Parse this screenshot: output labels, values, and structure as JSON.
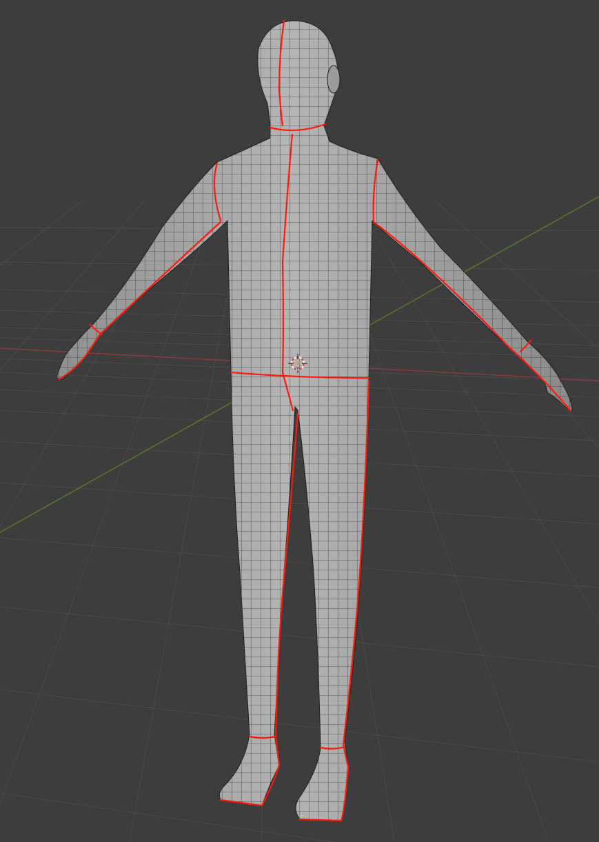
{
  "viewport": {
    "name": "3D Viewport",
    "background_color": "#3d3d3d",
    "grid_color": "#4a4a4a",
    "x_axis_color": "#8a3a43",
    "y_axis_color": "#5d7a2e"
  },
  "mesh": {
    "object": "human-base-mesh",
    "surface_color": "#a9a9a9",
    "wire_color": "#1e1e1e",
    "seam_color": "#ff1a0a"
  },
  "cursor": {
    "icon": "3d-cursor-icon",
    "ring_color": "#ffffff",
    "dash_color": "#e03030"
  }
}
